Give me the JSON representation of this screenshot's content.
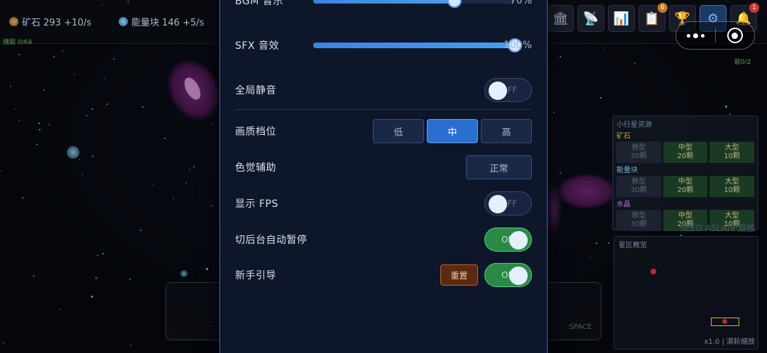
{
  "topbar": {
    "ore": {
      "label": "矿石 293 +10/s",
      "icon": "ore-icon"
    },
    "energy": {
      "label": "能量块 146 +5/s",
      "icon": "energy-icon"
    },
    "left_sub": "储能 0/64",
    "right_sub": "能0/2",
    "buttons": [
      {
        "name": "bank-icon",
        "glyph": "🏛"
      },
      {
        "name": "satellite-icon",
        "glyph": "📡"
      },
      {
        "name": "chart-icon",
        "glyph": "📊"
      },
      {
        "name": "clipboard-icon",
        "glyph": "📋",
        "badge": "6"
      },
      {
        "name": "trophy-icon",
        "glyph": "🏆"
      },
      {
        "name": "gear-icon",
        "glyph": "⚙",
        "active": true
      },
      {
        "name": "bell-icon",
        "glyph": "🔔",
        "badge": "1"
      }
    ]
  },
  "settings": {
    "bgm": {
      "label": "BGM 音乐",
      "value_text": "70%",
      "value": 70
    },
    "sfx": {
      "label": "SFX 音效",
      "value_text": "100%",
      "value": 100
    },
    "mute": {
      "label": "全局静音",
      "state": "OFF"
    },
    "quality": {
      "label": "画质档位",
      "options": [
        "低",
        "中",
        "高"
      ],
      "selected": "中"
    },
    "colorblind": {
      "label": "色觉辅助",
      "value": "正常"
    },
    "fps": {
      "label": "显示 FPS",
      "state": "OFF"
    },
    "autopause": {
      "label": "切后台自动暂停",
      "state": "ON"
    },
    "tutorial": {
      "label": "新手引导",
      "reset_label": "重置",
      "state": "ON"
    }
  },
  "side_panel": {
    "title": "小行星资源",
    "categories": [
      {
        "name": "矿石",
        "color": "#c9a24a",
        "cells": [
          {
            "t": "微型",
            "v": "30颗"
          },
          {
            "t": "中型",
            "v": "20颗"
          },
          {
            "t": "大型",
            "v": "10颗"
          }
        ]
      },
      {
        "name": "能量块",
        "color": "#6fb3d8",
        "cells": [
          {
            "t": "微型",
            "v": "30颗"
          },
          {
            "t": "中型",
            "v": "20颗"
          },
          {
            "t": "大型",
            "v": "10颗"
          }
        ]
      },
      {
        "name": "水晶",
        "color": "#b070d8",
        "cells": [
          {
            "t": "微型",
            "v": "30颗"
          },
          {
            "t": "中型",
            "v": "20颗"
          },
          {
            "t": "大型",
            "v": "10颗"
          }
        ]
      }
    ],
    "seed": "SEED ASLAIV 双核"
  },
  "minimap": {
    "label": "星区概览",
    "zoom": "x1.0 | 滚轮缩放"
  },
  "bottom": {
    "hint": "· SPACE"
  }
}
